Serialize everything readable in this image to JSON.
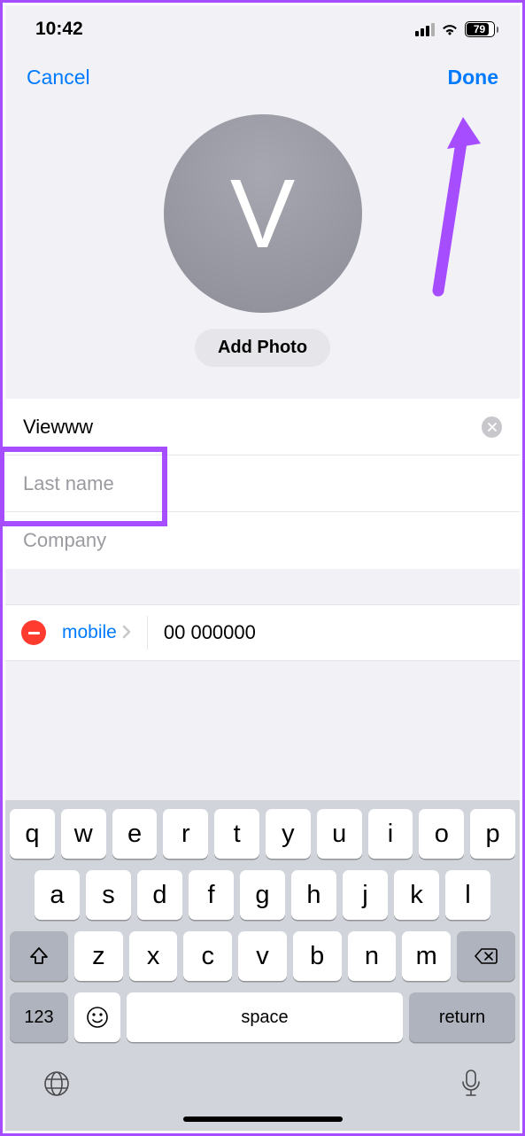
{
  "status": {
    "time": "10:42",
    "battery": "79"
  },
  "nav": {
    "cancel": "Cancel",
    "done": "Done"
  },
  "avatar": {
    "initial": "V",
    "add_photo": "Add Photo"
  },
  "fields": {
    "first_name_value": "Viewww",
    "last_name_placeholder": "Last name",
    "company_placeholder": "Company"
  },
  "phone": {
    "label": "mobile",
    "value": "00 000000"
  },
  "keyboard": {
    "row1": [
      "q",
      "w",
      "e",
      "r",
      "t",
      "y",
      "u",
      "i",
      "o",
      "p"
    ],
    "row2": [
      "a",
      "s",
      "d",
      "f",
      "g",
      "h",
      "j",
      "k",
      "l"
    ],
    "row3": [
      "z",
      "x",
      "c",
      "v",
      "b",
      "n",
      "m"
    ],
    "num": "123",
    "space": "space",
    "return": "return"
  }
}
